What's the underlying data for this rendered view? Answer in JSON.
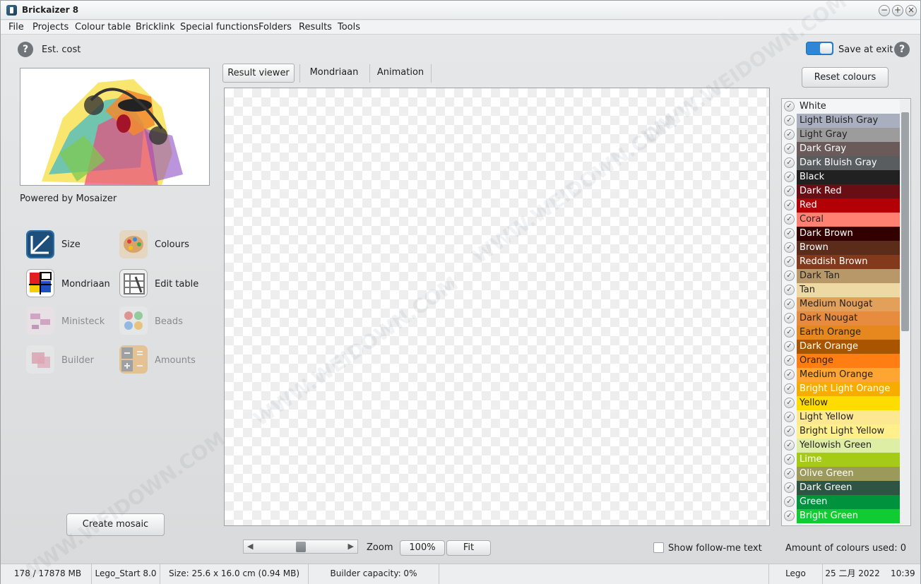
{
  "window": {
    "title": "Brickaizer 8"
  },
  "menu": [
    "File",
    "Projects",
    "Colour table",
    "Bricklink",
    "Special functions",
    "Folders",
    "Results",
    "Tools"
  ],
  "left": {
    "est_cost": "Est. cost",
    "powered_by": "Powered by Mosaizer",
    "functions": [
      {
        "label": "Size",
        "icon": "size-icon",
        "enabled": true
      },
      {
        "label": "Colours",
        "icon": "palette-icon",
        "enabled": true
      },
      {
        "label": "Mondriaan",
        "icon": "mondriaan-icon",
        "enabled": true
      },
      {
        "label": "Edit table",
        "icon": "edit-table-icon",
        "enabled": true
      },
      {
        "label": "Ministeck",
        "icon": "ministeck-icon",
        "enabled": false
      },
      {
        "label": "Beads",
        "icon": "beads-icon",
        "enabled": false
      },
      {
        "label": "Builder",
        "icon": "builder-icon",
        "enabled": false
      },
      {
        "label": "Amounts",
        "icon": "calculator-icon",
        "enabled": false
      }
    ],
    "create_button": "Create mosaic"
  },
  "tabs": [
    "Result viewer",
    "Mondriaan",
    "Animation"
  ],
  "right": {
    "save_at_exit": "Save at exit",
    "reset_colours": "Reset colours",
    "colours": [
      {
        "name": "White",
        "bg": "#f4f5f6",
        "fg": "#222222"
      },
      {
        "name": "Light Bluish Gray",
        "bg": "#a9afbf",
        "fg": "#222222"
      },
      {
        "name": "Light Gray",
        "bg": "#9c9c9c",
        "fg": "#222222"
      },
      {
        "name": "Dark Gray",
        "bg": "#6b5a5a",
        "fg": "#ffffff"
      },
      {
        "name": "Dark Bluish Gray",
        "bg": "#595d60",
        "fg": "#ffffff"
      },
      {
        "name": "Black",
        "bg": "#212121",
        "fg": "#ffffff"
      },
      {
        "name": "Dark Red",
        "bg": "#6a0e15",
        "fg": "#ffffff"
      },
      {
        "name": "Red",
        "bg": "#b30006",
        "fg": "#ffffff"
      },
      {
        "name": "Coral",
        "bg": "#ff8172",
        "fg": "#222222"
      },
      {
        "name": "Dark Brown",
        "bg": "#330000",
        "fg": "#ffffff"
      },
      {
        "name": "Brown",
        "bg": "#5c2c1a",
        "fg": "#ffffff"
      },
      {
        "name": "Reddish Brown",
        "bg": "#82391c",
        "fg": "#ffffff"
      },
      {
        "name": "Dark Tan",
        "bg": "#b89869",
        "fg": "#222222"
      },
      {
        "name": "Tan",
        "bg": "#eed9a4",
        "fg": "#222222"
      },
      {
        "name": "Medium Nougat",
        "bg": "#e3a05b",
        "fg": "#222222"
      },
      {
        "name": "Dark Nougat",
        "bg": "#e78b3e",
        "fg": "#222222"
      },
      {
        "name": "Earth Orange",
        "bg": "#e6881d",
        "fg": "#222222"
      },
      {
        "name": "Dark Orange",
        "bg": "#a95500",
        "fg": "#ffffff"
      },
      {
        "name": "Orange",
        "bg": "#ff7e14",
        "fg": "#222222"
      },
      {
        "name": "Medium Orange",
        "bg": "#ffa531",
        "fg": "#222222"
      },
      {
        "name": "Bright Light Orange",
        "bg": "#f7ad00",
        "fg": "#ffffff"
      },
      {
        "name": "Yellow",
        "bg": "#ffdc00",
        "fg": "#222222"
      },
      {
        "name": "Light Yellow",
        "bg": "#fbe890",
        "fg": "#222222"
      },
      {
        "name": "Bright Light Yellow",
        "bg": "#fff08c",
        "fg": "#222222"
      },
      {
        "name": "Yellowish Green",
        "bg": "#dfeea5",
        "fg": "#222222"
      },
      {
        "name": "Lime",
        "bg": "#a5ca18",
        "fg": "#ffffff"
      },
      {
        "name": "Olive Green",
        "bg": "#9b9a5a",
        "fg": "#ffffff"
      },
      {
        "name": "Dark Green",
        "bg": "#2e5543",
        "fg": "#ffffff"
      },
      {
        "name": "Green",
        "bg": "#00923d",
        "fg": "#ffffff"
      },
      {
        "name": "Bright Green",
        "bg": "#10cb31",
        "fg": "#ffffff"
      }
    ]
  },
  "bottom": {
    "zoom_label": "Zoom",
    "zoom_100": "100%",
    "fit": "Fit",
    "follow_me": "Show follow-me text",
    "colours_used": "Amount of colours used: 0"
  },
  "status": [
    "178 / 17878 MB",
    "Lego_Start 8.0",
    "Size: 25.6 x 16.0 cm (0.94 MB)",
    "Builder capacity: 0%",
    "",
    "Lego",
    "25 二月 2022    10:39"
  ],
  "watermark": "WWW.WEIDOWN.COM"
}
